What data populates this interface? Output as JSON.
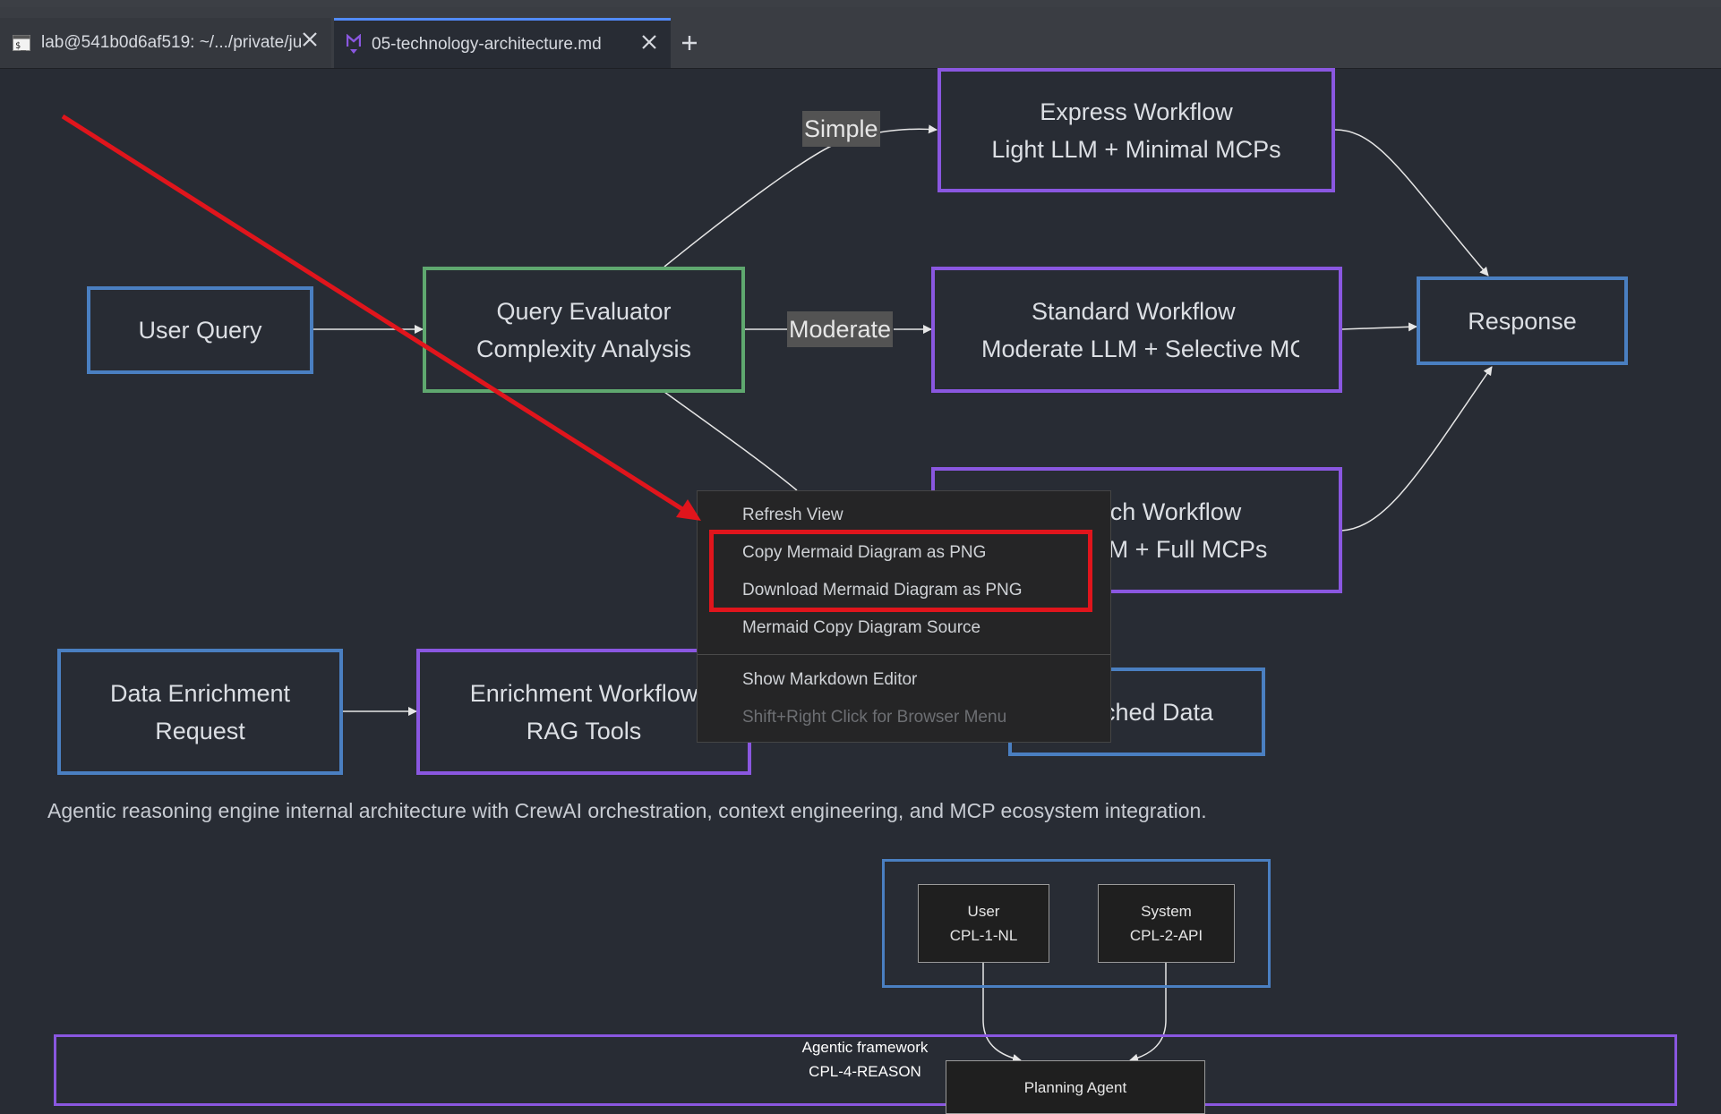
{
  "tabs": [
    {
      "label": "lab@541b0d6af519: ~/.../private/jupyter",
      "icon": "terminal-icon"
    },
    {
      "label": "05-technology-architecture.md",
      "icon": "markdown-icon",
      "active": true
    }
  ],
  "new_tab_icon": "plus-icon",
  "diagram": {
    "nodes": {
      "user_query": "User Query",
      "evaluator_l1": "Query Evaluator",
      "evaluator_l2": "Complexity Analysis",
      "express_l1": "Express Workflow",
      "express_l2": "Light LLM + Minimal MCPs",
      "standard_l1": "Standard Workflow",
      "standard_l2": "Moderate LLM + Selective MCPs",
      "research_l1": "Research Workflow",
      "research_l2": "Heavy LLM + Full MCPs",
      "response": "Response",
      "enrich_req_l1": "Data Enrichment",
      "enrich_req_l2": "Request",
      "enrich_wf_l1": "Enrichment Workflow",
      "enrich_wf_l2": "RAG Tools",
      "enriched": "Enriched Data"
    },
    "edge_labels": {
      "simple": "Simple",
      "moderate": "Moderate"
    },
    "caption": "Agentic reasoning engine internal architecture with CrewAI orchestration, context engineering, and MCP ecosystem integration.",
    "second": {
      "user_l1": "User",
      "user_l2": "CPL-1-NL",
      "system_l1": "System",
      "system_l2": "CPL-2-API",
      "framework_l1": "Agentic framework",
      "framework_l2": "CPL-4-REASON",
      "planning": "Planning Agent"
    }
  },
  "context_menu": {
    "refresh": "Refresh View",
    "copy_png": "Copy Mermaid Diagram as PNG",
    "download_png": "Download Mermaid Diagram as PNG",
    "copy_source": "Mermaid Copy Diagram Source",
    "show_editor": "Show Markdown Editor",
    "browser_hint": "Shift+Right Click for Browser Menu"
  },
  "colors": {
    "background": "#282c34",
    "blue_border": "#4a7fc1",
    "green_border": "#5fa86f",
    "purple_border": "#8a57e0",
    "annotation_red": "#e0151c"
  }
}
